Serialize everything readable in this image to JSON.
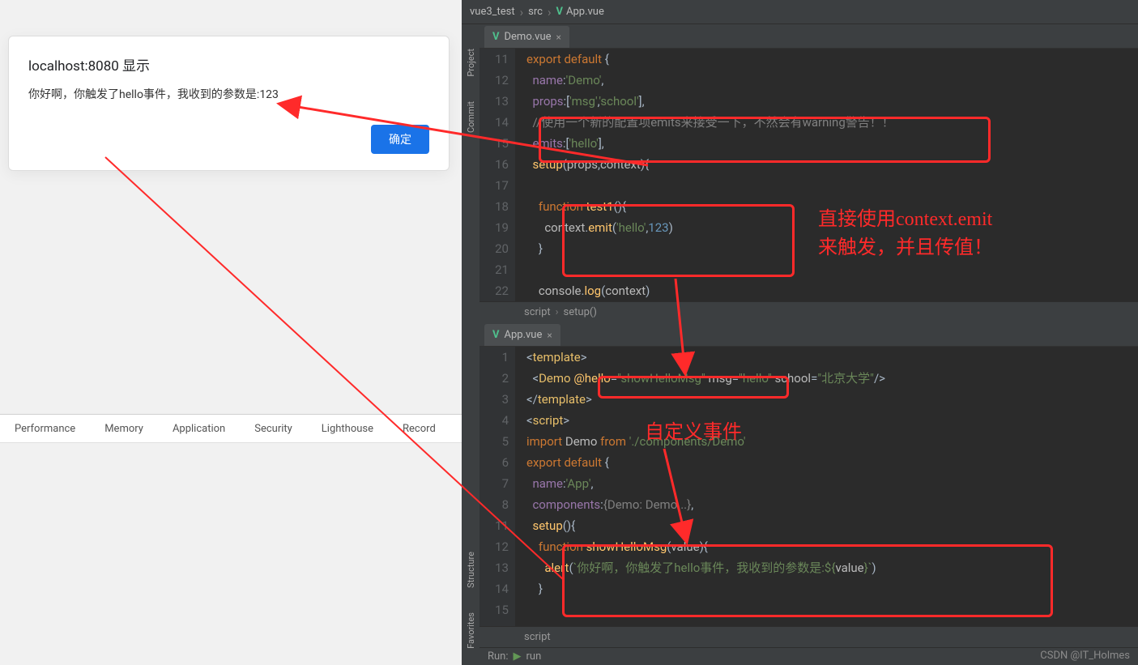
{
  "alert": {
    "title": "localhost:8080 显示",
    "message": "你好啊，你触发了hello事件，我收到的参数是:123",
    "ok": "确定"
  },
  "devtools_tabs": [
    "Performance",
    "Memory",
    "Application",
    "Security",
    "Lighthouse",
    "Record"
  ],
  "breadcrumb": {
    "project": "vue3_test",
    "folder": "src",
    "file": "App.vue"
  },
  "toolstrip_top": [
    "Project",
    "Commit"
  ],
  "toolstrip_bottom": [
    "Structure",
    "Favorites"
  ],
  "tabs_top": {
    "name": "Demo.vue"
  },
  "tabs_bottom": {
    "name": "App.vue"
  },
  "crumbs_top": {
    "a": "script",
    "b": "setup()"
  },
  "crumbs_bottom": {
    "a": "script"
  },
  "run": {
    "label": "Run:",
    "conf": "run"
  },
  "annotations": {
    "a1_l1": "直接使用context.emit",
    "a1_l2": "来触发，并且传值！",
    "a2": "自定义事件"
  },
  "watermark": "CSDN @IT_Holmes",
  "code_top": {
    "start": 11,
    "lines": [
      {
        "n": 11,
        "html": "<span class='kw'>export default</span> {"
      },
      {
        "n": 12,
        "html": "  <span class='pname'>name</span><span class='op'>:</span><span class='str'>'Demo'</span><span class='op'>,</span>"
      },
      {
        "n": 13,
        "html": "  <span class='pname'>props</span><span class='op'>:[</span><span class='str'>'msg'</span><span class='op'>,</span><span class='str'>'school'</span><span class='op'>],</span>"
      },
      {
        "n": 14,
        "html": "  <span class='cmt'>//使用一个新的配置项emits来接受一下，不然会有warning警告！！</span>"
      },
      {
        "n": 15,
        "html": "  <span class='pname'>emits</span><span class='op'>:[</span><span class='str'>'hello'</span><span class='op'>],</span>"
      },
      {
        "n": 16,
        "html": "  <span class='name'>setup</span><span class='op'>(</span><span class='attr'>props</span><span class='op'>,</span><span class='attr'>context</span><span class='op'>){</span>"
      },
      {
        "n": 17,
        "html": ""
      },
      {
        "n": 18,
        "html": "    <span class='kw'>function</span> <span class='name'>test1</span><span class='op'>(){</span>"
      },
      {
        "n": 19,
        "html": "      <span class='attr'>context</span><span class='op'>.</span><span class='name'>emit</span><span class='op'>(</span><span class='str'>'hello'</span><span class='op'>,</span><span class='num'>123</span><span class='op'>)</span>"
      },
      {
        "n": 20,
        "html": "    <span class='op'>}</span>"
      },
      {
        "n": 21,
        "html": ""
      },
      {
        "n": 22,
        "html": "    <span class='attr'>console</span><span class='op'>.</span><span class='name'>log</span><span class='op'>(</span><span class='attr'>context</span><span class='op'>)</span>"
      }
    ]
  },
  "code_bottom": {
    "lines": [
      {
        "n": 1,
        "html": "<span class='op'>&lt;</span><span class='tag'>template</span><span class='op'>&gt;</span>"
      },
      {
        "n": 2,
        "html": "  <span class='op'>&lt;</span><span class='tag'>Demo</span> <span class='light-y'>@hello</span><span class='op'>=</span><span class='str'>\"showHelloMsg\"</span> <span class='attr'>msg</span><span class='op'>=</span><span class='str'>\"hello\"</span> <span class='attr'>school</span><span class='op'>=</span><span class='str'>\"北京大学\"</span><span class='op'>/&gt;</span>"
      },
      {
        "n": 3,
        "html": "<span class='op'>&lt;/</span><span class='tag'>template</span><span class='op'>&gt;</span>"
      },
      {
        "n": 4,
        "html": "<span class='op'>&lt;</span><span class='tag'>script</span><span class='op'>&gt;</span>"
      },
      {
        "n": 5,
        "html": "<span class='kw'>import</span> <span class='attr'>Demo</span> <span class='kw'>from</span> <span class='str'>'./components/Demo'</span>"
      },
      {
        "n": 6,
        "html": "<span class='kw'>export default</span> {"
      },
      {
        "n": 7,
        "html": "  <span class='pname'>name</span><span class='op'>:</span><span class='str'>'App'</span><span class='op'>,</span>"
      },
      {
        "n": 8,
        "html": "  <span class='pname'>components</span><span class='op'>:</span><span class='cmt'>{Demo: Demo...}</span><span class='op'>,</span>"
      },
      {
        "n": 11,
        "html": "  <span class='name'>setup</span><span class='op'>(){</span>"
      },
      {
        "n": 12,
        "html": "    <span class='kw'>function</span> <span class='name'>showHelloMsg</span><span class='op'>(</span><span class='attr'>value</span><span class='op'>){</span>"
      },
      {
        "n": 13,
        "html": "      <span class='name'>alert</span><span class='op'>(</span><span class='str'>`你好啊，你触发了hello事件，我收到的参数是:${</span><span class='attr'>value</span><span class='str'>}`</span><span class='op'>)</span>"
      },
      {
        "n": 14,
        "html": "    <span class='op'>}</span>"
      },
      {
        "n": 15,
        "html": ""
      }
    ]
  }
}
